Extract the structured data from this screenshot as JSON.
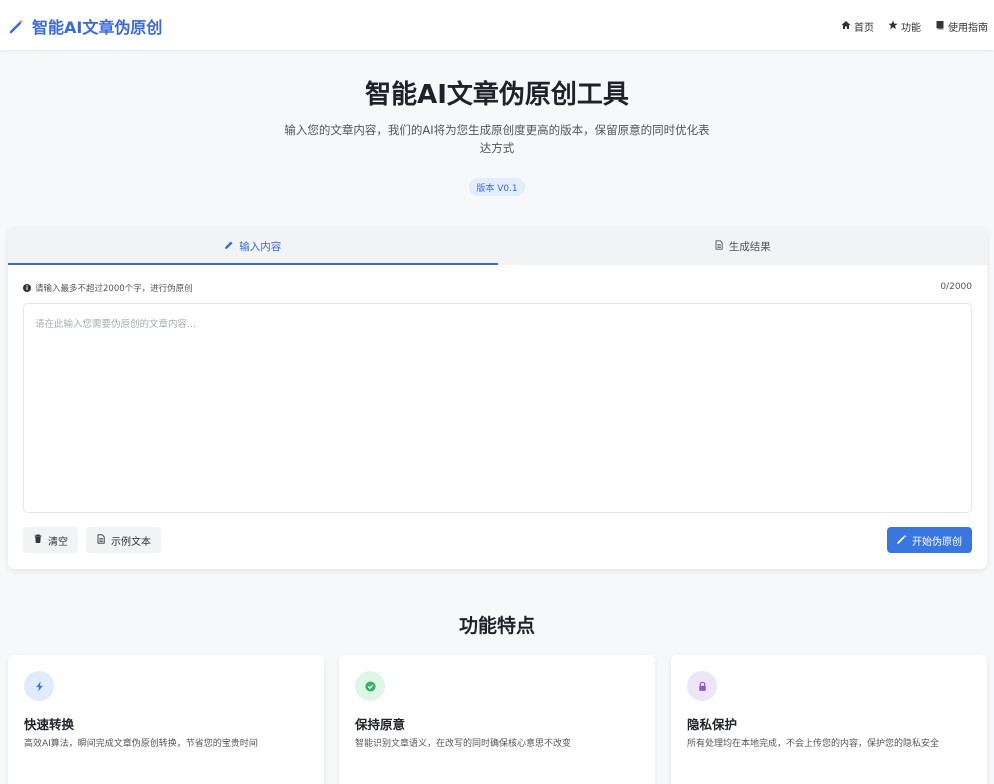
{
  "header": {
    "logo_text": "智能AI文章伪原创",
    "nav": [
      {
        "label": "首页",
        "icon": "home-icon"
      },
      {
        "label": "功能",
        "icon": "star-icon"
      },
      {
        "label": "使用指南",
        "icon": "book-icon"
      }
    ]
  },
  "hero": {
    "title": "智能AI文章伪原创工具",
    "subtitle": "输入您的文章内容，我们的AI将为您生成原创度更高的版本，保留原意的同时优化表达方式",
    "version_badge": "版本 V0.1"
  },
  "editor": {
    "tabs": [
      {
        "label": "输入内容",
        "icon": "pencil-icon",
        "active": true
      },
      {
        "label": "生成结果",
        "icon": "document-icon",
        "active": false
      }
    ],
    "hint": "请输入最多不超过2000个字，进行伪原创",
    "counter": "0/2000",
    "placeholder": "请在此输入您需要伪原创的文章内容...",
    "clear_label": "清空",
    "sample_label": "示例文本",
    "start_label": "开始伪原创"
  },
  "features": {
    "title": "功能特点",
    "items": [
      {
        "name": "快速转换",
        "desc": "高效AI算法，瞬间完成文章伪原创转换，节省您的宝贵时间",
        "icon": "bolt-icon",
        "color": "#3a76e0"
      },
      {
        "name": "保持原意",
        "desc": "智能识别文章语义，在改写的同时确保核心意思不改变",
        "icon": "check-circle-icon",
        "color": "#2fb463"
      },
      {
        "name": "隐私保护",
        "desc": "所有处理均在本地完成，不会上传您的内容，保护您的隐私安全",
        "icon": "lock-icon",
        "color": "#8a5cd6"
      }
    ]
  },
  "colors": {
    "accent": "#3a6ad8",
    "button_primary": "#3a76e0"
  }
}
